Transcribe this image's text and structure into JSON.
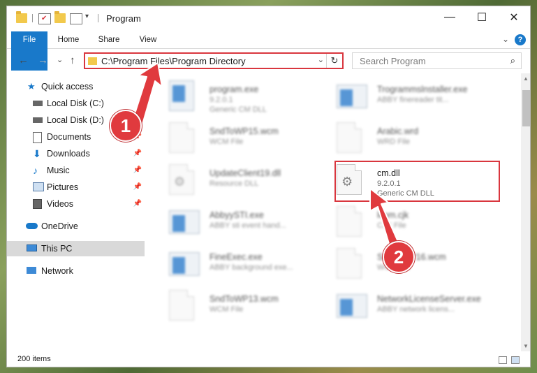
{
  "window": {
    "title": "Program"
  },
  "controls": {
    "minimize": "—",
    "maximize": "☐",
    "close": "✕"
  },
  "ribbon": {
    "tabs": [
      "File",
      "Home",
      "Share",
      "View"
    ],
    "expand": "⌄",
    "help": "?"
  },
  "nav": {
    "back": "←",
    "forward": "→",
    "recent": "⌄",
    "up": "↑"
  },
  "address": {
    "path": "C:\\Program Files\\Program Directory",
    "dropdown": "⌄",
    "refresh": "↻"
  },
  "search": {
    "placeholder": "Search Program",
    "icon": "⌕"
  },
  "sidebar": {
    "items": [
      {
        "label": "Quick access",
        "icon": "star-icon",
        "pinned": false
      },
      {
        "label": "Local Disk (C:)",
        "icon": "drive-icon",
        "pinned": false
      },
      {
        "label": "Local Disk (D:)",
        "icon": "drive-icon",
        "pinned": false
      },
      {
        "label": "Documents",
        "icon": "documents-icon",
        "pinned": true
      },
      {
        "label": "Downloads",
        "icon": "downloads-icon",
        "pinned": true
      },
      {
        "label": "Music",
        "icon": "music-icon",
        "pinned": true
      },
      {
        "label": "Pictures",
        "icon": "pictures-icon",
        "pinned": true
      },
      {
        "label": "Videos",
        "icon": "videos-icon",
        "pinned": true
      },
      {
        "label": "OneDrive",
        "icon": "cloud-icon",
        "pinned": false
      },
      {
        "label": "This PC",
        "icon": "pc-icon",
        "pinned": false
      },
      {
        "label": "Network",
        "icon": "network-icon",
        "pinned": false
      }
    ],
    "pin_glyph": "📌"
  },
  "files": [
    {
      "name": "program.exe",
      "line2": "9.2.0.1",
      "line3": "Generic CM DLL",
      "kind": "exe"
    },
    {
      "name": "Trogrammslnstaller.exe",
      "line2": "ABBY finereader tit...",
      "line3": "",
      "kind": "exe"
    },
    {
      "name": "SndToWP15.wcm",
      "line2": "WCM File",
      "line3": "",
      "kind": "doc"
    },
    {
      "name": "Arabic.wrd",
      "line2": "WRD File",
      "line3": "",
      "kind": "doc"
    },
    {
      "name": "UpdateClient19.dll",
      "line2": "Resource DLL",
      "line3": "",
      "kind": "dll"
    },
    {
      "name": "cm.dll",
      "line2": "9.2.0.1",
      "line3": "Generic CM DLL",
      "kind": "dll"
    },
    {
      "name": "AbbyySTI.exe",
      "line2": "ABBY sti event hand...",
      "line3": "",
      "kind": "exe"
    },
    {
      "name": "lcom.cjk",
      "line2": "CJK File",
      "line3": "",
      "kind": "doc"
    },
    {
      "name": "FineExec.exe",
      "line2": "ABBY background exe...",
      "line3": "",
      "kind": "exe"
    },
    {
      "name": "SndToWP16.wcm",
      "line2": "WCM File",
      "line3": "",
      "kind": "doc"
    },
    {
      "name": "SndToWP13.wcm",
      "line2": "WCM File",
      "line3": "",
      "kind": "doc"
    },
    {
      "name": "NetworkLicenseServer.exe",
      "line2": "ABBY network licens...",
      "line3": "",
      "kind": "exe"
    }
  ],
  "status": {
    "count": "200 items"
  },
  "callouts": [
    "1",
    "2"
  ],
  "colors": {
    "accent": "#1979ca",
    "highlight": "#d9363e",
    "selection": "#d9d9d9"
  }
}
